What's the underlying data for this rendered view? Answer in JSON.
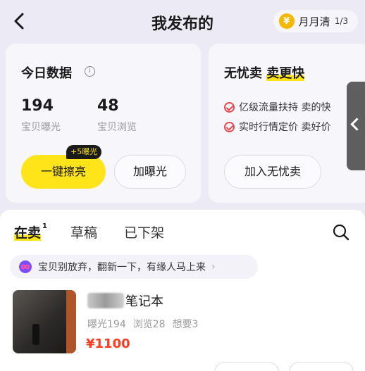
{
  "header": {
    "title": "我发布的",
    "pill_label": "月月清",
    "pill_fraction": "1/3"
  },
  "today_data": {
    "title": "今日数据",
    "exposure_value": "194",
    "exposure_label": "宝贝曝光",
    "views_value": "48",
    "views_label": "宝贝浏览",
    "polish_button": "一键擦亮",
    "polish_badge": "+5曝光",
    "boost_button": "加曝光"
  },
  "worry_free": {
    "title_plain": "无忧卖",
    "title_highlight": "卖更快",
    "bullet_1": "亿级流量扶持 卖的快",
    "bullet_2": "实时行情定价 卖好价",
    "join_button": "加入无忧卖"
  },
  "tabs": {
    "selling": "在卖",
    "selling_count": "1",
    "drafts": "草稿",
    "off_shelf": "已下架"
  },
  "banner": {
    "text": "宝贝别放弃，翻新一下，有缘人马上来",
    "chevron": "›"
  },
  "item": {
    "title": "笔记本",
    "exposure": "曝光194",
    "views": "浏览28",
    "wants": "想要3",
    "price": "¥1100"
  },
  "colors": {
    "accent_yellow": "#ffe41a",
    "price_red": "#ff3b1f",
    "check_red": "#e5484d"
  },
  "icons": [
    "back-arrow-icon",
    "coin-icon",
    "info-icon",
    "check-circle-icon",
    "search-icon",
    "infinity-icon",
    "chevron-right-icon",
    "collapse-arrow-icon"
  ]
}
